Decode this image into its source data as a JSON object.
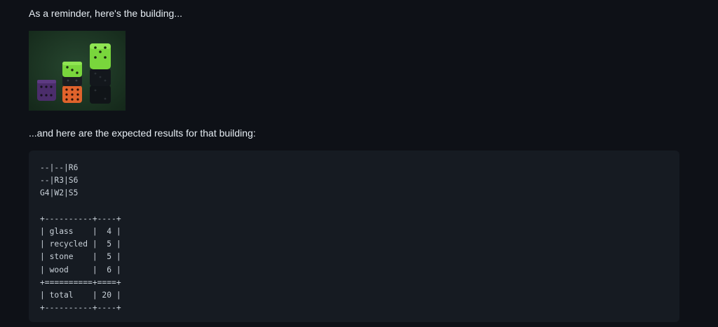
{
  "intro_text": "As a reminder, here's the building...",
  "image": {
    "subject": "stacked dice building",
    "colors": {
      "background": "#1f3b27",
      "glass_die": "#4b2d6b",
      "recycled_die": "#e0632c",
      "green_die": "#79d63c",
      "stone_die": "#101418"
    }
  },
  "outro_text": "...and here are the expected results for that building:",
  "code_lines": [
    "--|--|R6",
    "--|R3|S6",
    "G4|W2|S5",
    "",
    "+----------+----+",
    "| glass    |  4 |",
    "| recycled |  5 |",
    "| stone    |  5 |",
    "| wood     |  6 |",
    "+==========+====+",
    "| total    | 20 |",
    "+----------+----+"
  ]
}
